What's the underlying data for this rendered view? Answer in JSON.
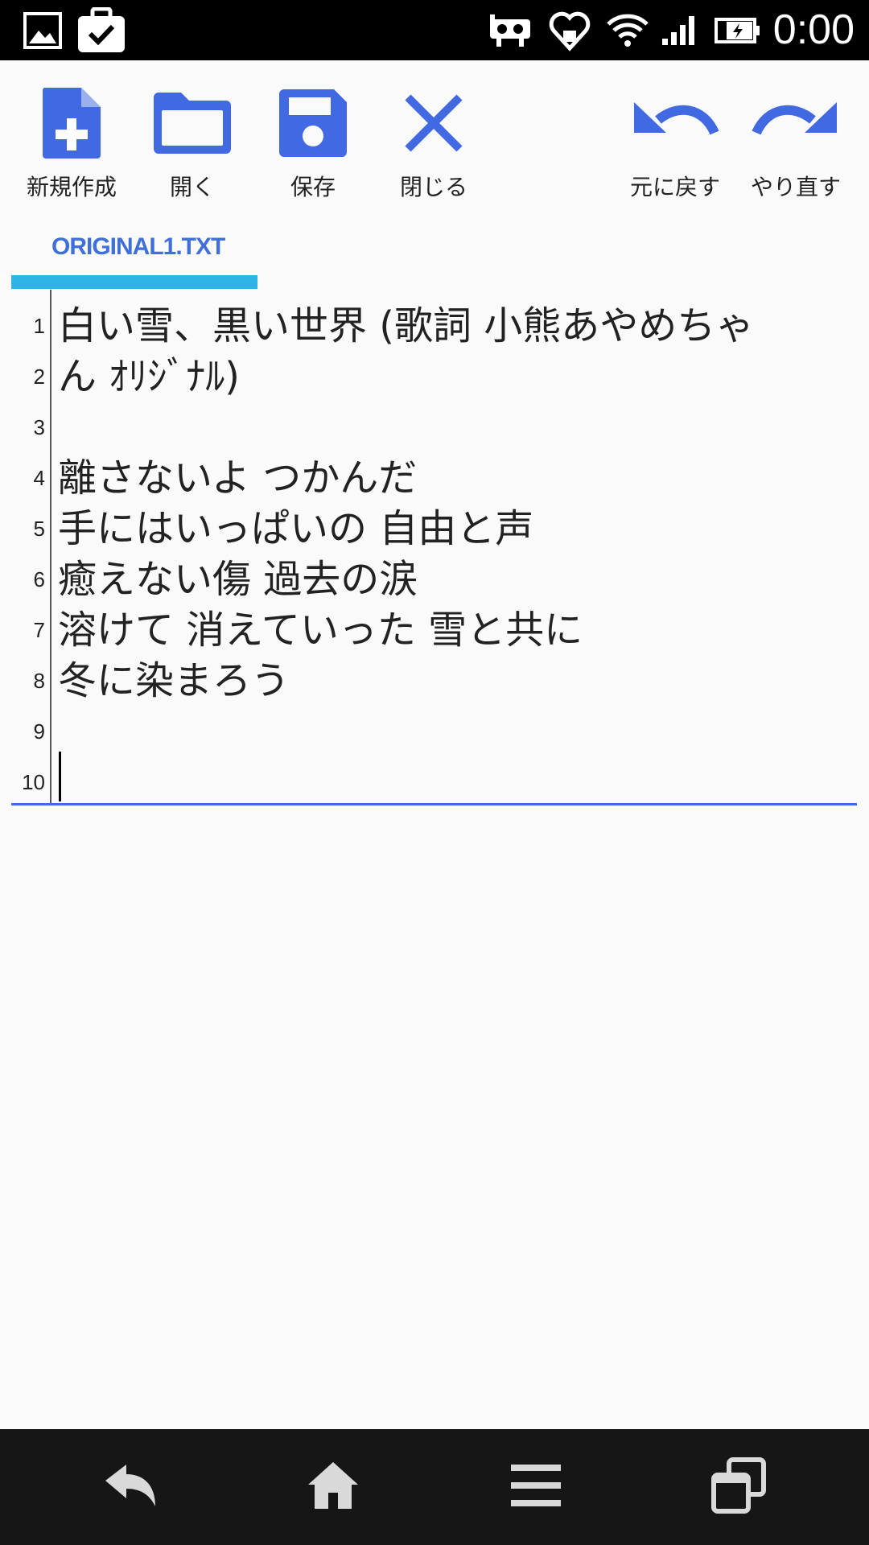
{
  "status_bar": {
    "time": "0:00",
    "icons": [
      "image-icon",
      "briefcase-check-icon",
      "vr-headset-icon",
      "heart-download-icon",
      "wifi-icon",
      "signal-icon",
      "battery-charging-icon"
    ]
  },
  "toolbar": {
    "new_label": "新規作成",
    "open_label": "開く",
    "save_label": "保存",
    "close_label": "閉じる",
    "undo_label": "元に戻す",
    "redo_label": "やり直す",
    "accent_color": "#4169e1"
  },
  "tab": {
    "label": "ORIGINAL1.TXT",
    "underline_color": "#2eb3e6"
  },
  "editor": {
    "line_numbers": [
      "1",
      "2",
      "3",
      "4",
      "5",
      "6",
      "7",
      "8",
      "9",
      "10"
    ],
    "lines": [
      "白い雪、黒い世界 (歌詞 小熊あやめちゃ",
      "ん ｵﾘｼﾞﾅﾙ)",
      "",
      "離さないよ つかんだ",
      "手にはいっぱいの 自由と声",
      "癒えない傷 過去の涙",
      "溶けて 消えていった 雪と共に",
      "冬に染まろう",
      "",
      ""
    ]
  },
  "nav_bar": {
    "buttons": [
      "back-icon",
      "home-icon",
      "menu-icon",
      "recent-apps-icon"
    ]
  }
}
